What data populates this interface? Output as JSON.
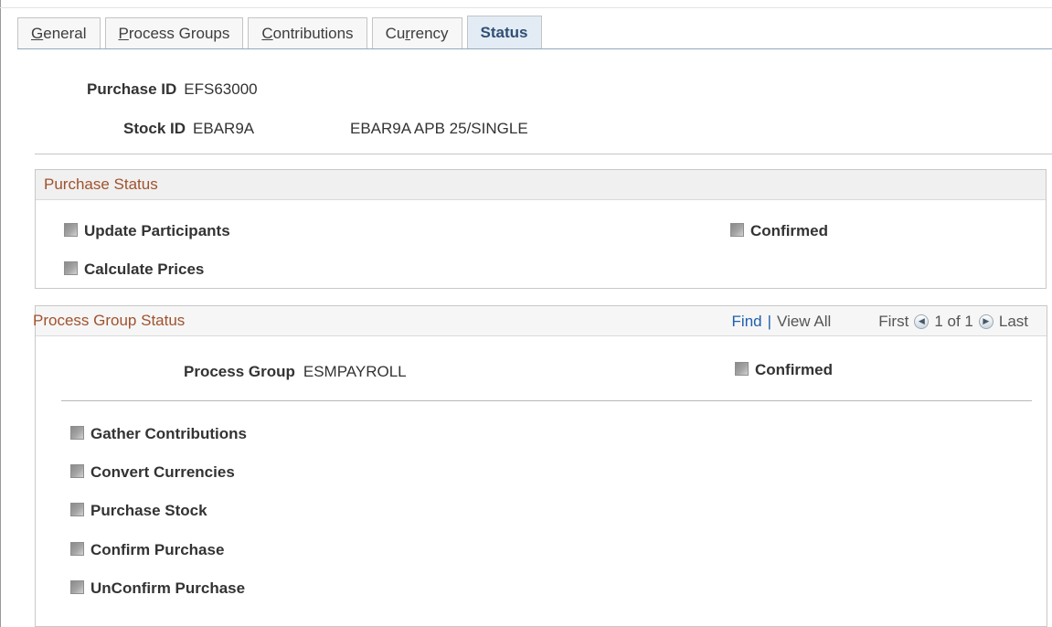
{
  "tabs": [
    {
      "pre": "",
      "ul": "G",
      "post": "eneral"
    },
    {
      "pre": "",
      "ul": "P",
      "post": "rocess Groups"
    },
    {
      "pre": "",
      "ul": "C",
      "post": "ontributions"
    },
    {
      "pre": "Cu",
      "ul": "r",
      "post": "rency"
    },
    {
      "pre": "Status",
      "ul": "",
      "post": ""
    }
  ],
  "header": {
    "purchase_id_label": "Purchase ID",
    "purchase_id": "EFS63000",
    "stock_id_label": "Stock ID",
    "stock_id": "EBAR9A",
    "stock_desc": "EBAR9A APB 25/SINGLE"
  },
  "purchase_status": {
    "title": "Purchase Status",
    "update_participants": "Update Participants",
    "calculate_prices": "Calculate Prices",
    "confirmed": "Confirmed"
  },
  "process_group_status": {
    "title": "Process Group Status",
    "find": "Find",
    "separator": "|",
    "view_all": "View All",
    "first": "First",
    "page": "1 of 1",
    "last": "Last",
    "process_group_label": "Process Group",
    "process_group": "ESMPAYROLL",
    "confirmed": "Confirmed",
    "steps": [
      "Gather Contributions",
      "Convert Currencies",
      "Purchase Stock",
      "Confirm Purchase",
      "UnConfirm Purchase"
    ]
  }
}
